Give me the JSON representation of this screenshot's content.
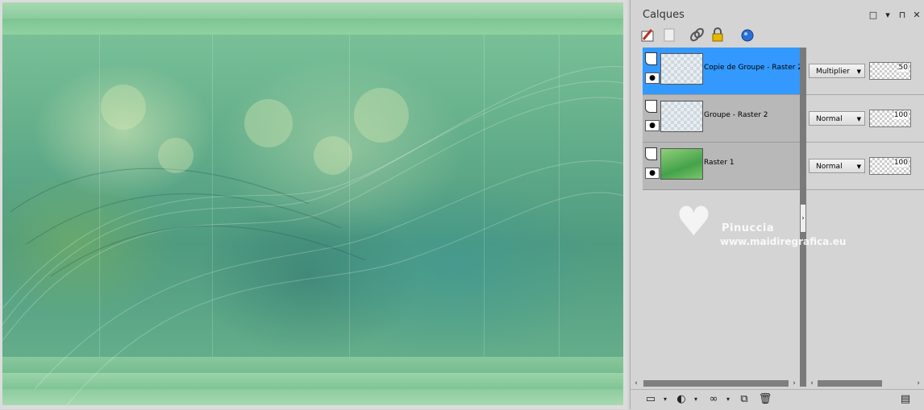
{
  "panel": {
    "title": "Calques",
    "title_controls": [
      "□",
      "▾",
      "⊓",
      "✕"
    ]
  },
  "toolbar": {
    "icons": [
      "brush-icon",
      "locked-layer-icon",
      "link-icon",
      "lock-icon",
      "globe-icon"
    ]
  },
  "layers": [
    {
      "name": "Copie de Groupe - Raster 2",
      "blend": "Multiplier",
      "opacity": "50",
      "selected": true,
      "thumb": "transparent"
    },
    {
      "name": "Groupe - Raster 2",
      "blend": "Normal",
      "opacity": "100",
      "selected": false,
      "thumb": "transparent"
    },
    {
      "name": "Raster 1",
      "blend": "Normal",
      "opacity": "100",
      "selected": false,
      "thumb": "green"
    }
  ],
  "watermark": {
    "name": "Pinuccia",
    "url": "www.maidiregrafica.eu"
  },
  "bottombar": {
    "icons": [
      "new-layer-icon",
      "mask-icon",
      "glasses-icon",
      "duplicate-icon",
      "trash-icon",
      "properties-icon"
    ]
  },
  "colors": {
    "selected": "#3399ff",
    "row": "#b8b8b8",
    "panel_bg": "#d4d4d4"
  }
}
